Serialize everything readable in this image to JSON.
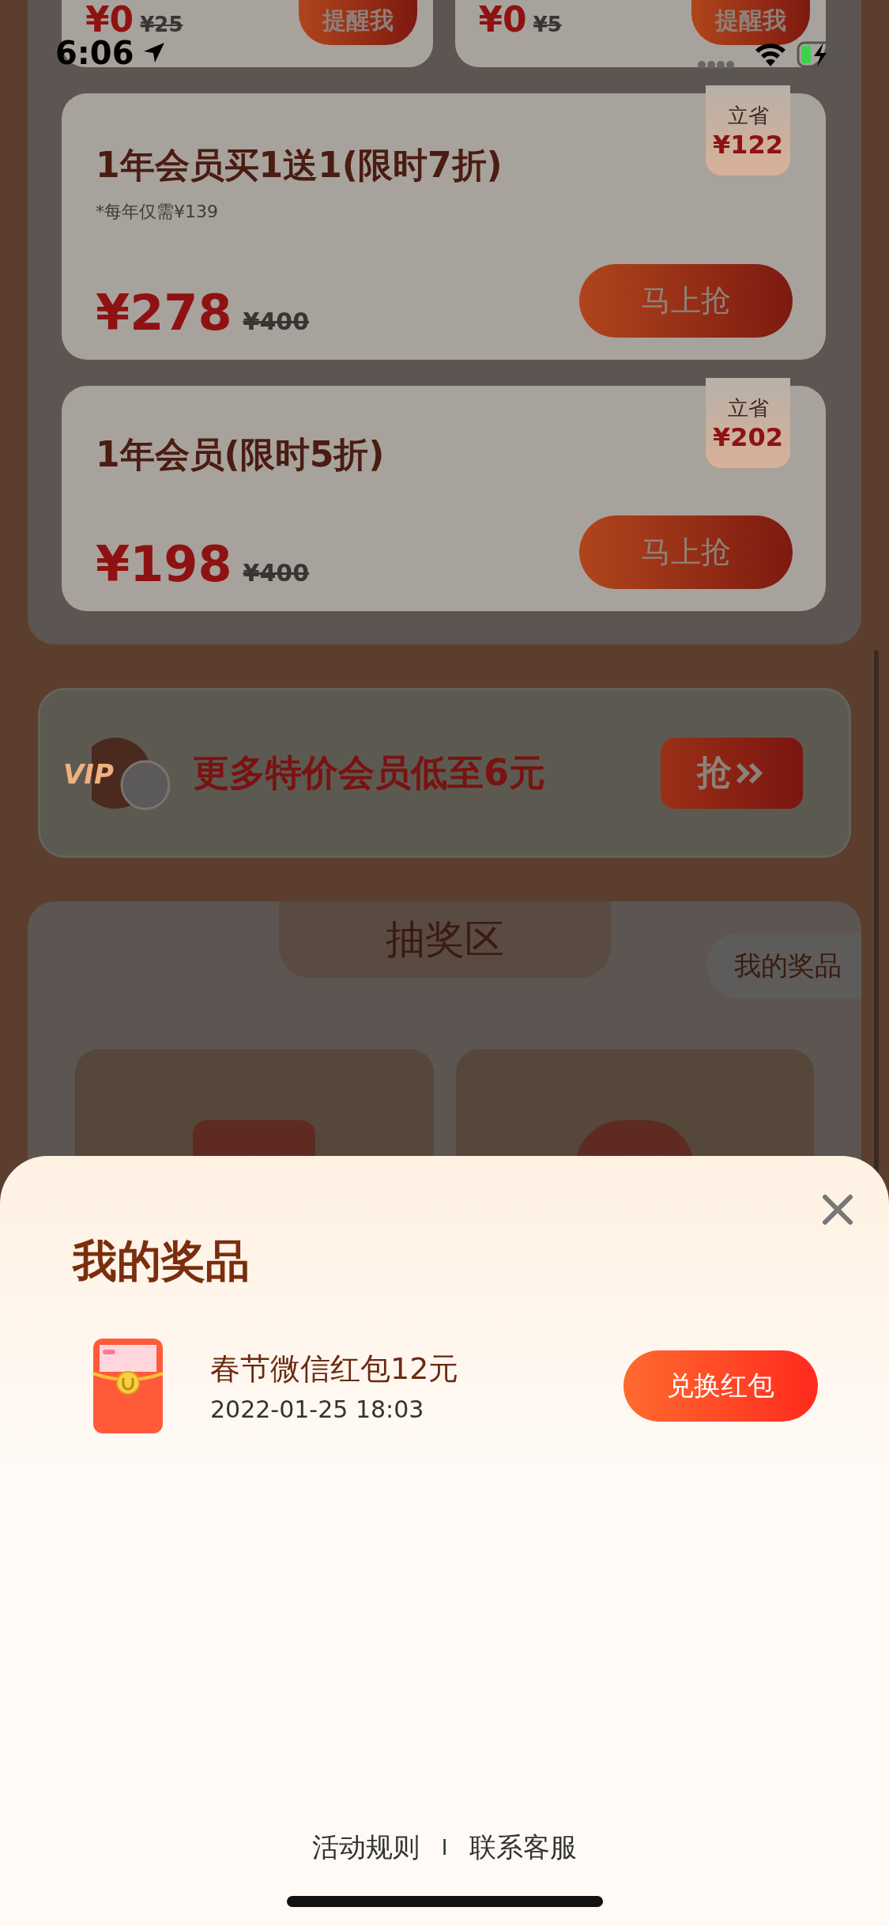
{
  "status_bar": {
    "time": "6:06"
  },
  "top_cards": [
    {
      "price": "¥0",
      "original_price": "¥25",
      "button": "提醒我"
    },
    {
      "price": "¥0",
      "original_price": "¥5",
      "button": "提醒我"
    }
  ],
  "offers": [
    {
      "title": "1年会员买1送1(限时7折)",
      "note": "*每年仅需¥139",
      "price": "¥278",
      "original_price": "¥400",
      "button": "马上抢",
      "badge_label": "立省",
      "badge_amount": "¥122"
    },
    {
      "title": "1年会员(限时5折)",
      "price": "¥198",
      "original_price": "¥400",
      "button": "马上抢",
      "badge_label": "立省",
      "badge_amount": "¥202"
    }
  ],
  "banner": {
    "icon_label": "VIP",
    "text": "更多特价会员低至6元",
    "button": "抢"
  },
  "lottery": {
    "title": "抽奖区",
    "my_prizes_button": "我的奖品"
  },
  "sheet": {
    "title": "我的奖品",
    "prizes": [
      {
        "name": "春节微信红包12元",
        "time": "2022-01-25 18:03",
        "button": "兑换红包"
      }
    ]
  },
  "footer": {
    "links": [
      "活动规则",
      "联系客服"
    ],
    "separator": "I"
  }
}
